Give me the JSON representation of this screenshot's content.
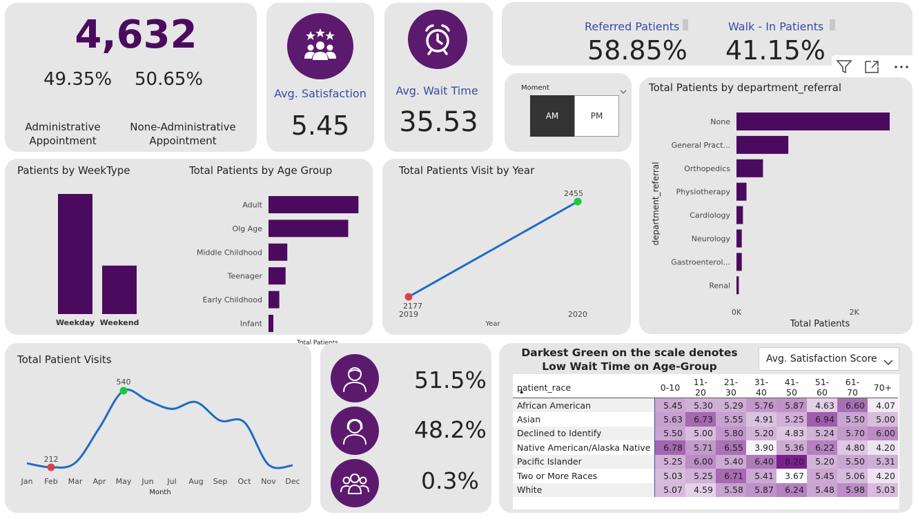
{
  "kpi_total": {
    "value": "4,632",
    "admin_pct": "49.35%",
    "nonadmin_pct": "50.65%",
    "admin_label_1": "Administrative",
    "admin_label_2": "Appointment",
    "nonadmin_label_1": "None-Administrative",
    "nonadmin_label_2": "Appointment"
  },
  "satisfaction": {
    "label": "Avg. Satisfaction",
    "value": "5.45",
    "icon": "people-stars-icon"
  },
  "wait": {
    "label": "Avg. Wait Time",
    "value": "35.53",
    "icon": "alarm-clock-icon"
  },
  "referral": {
    "referred_label": "Referred Patients",
    "referred_value": "58.85%",
    "walkin_label": "Walk - In Patients",
    "walkin_value": "41.15%"
  },
  "toolbar": {
    "filter_icon": "filter-icon",
    "focus_icon": "focus-mode-icon",
    "more_icon": "more-options-icon"
  },
  "moment": {
    "label": "Moment",
    "am": "AM",
    "pm": "PM",
    "selected": "AM"
  },
  "gender": {
    "male_pct": "51.5%",
    "female_pct": "48.2%",
    "other_pct": "0.3%"
  },
  "colors": {
    "bar": "#4a0b5e",
    "line": "#1e6bc4",
    "min_marker": "#d9434e",
    "max_marker": "#1ec83c",
    "card": "#e6e6e6",
    "accent": "#3a4aa8"
  },
  "chart_data": [
    {
      "id": "weektype",
      "type": "bar",
      "title": "Patients by WeekType",
      "categories": [
        "Weekday",
        "Weekend"
      ],
      "values": [
        3300,
        1332
      ],
      "ylim": [
        0,
        3300
      ]
    },
    {
      "id": "agegroup",
      "type": "bar",
      "orientation": "horizontal",
      "title": "Total Patients by Age Group",
      "xlabel": "Total Patients",
      "categories": [
        "Adult",
        "Olg Age",
        "Middle Childhood",
        "Teenager",
        "Early Childhood",
        "Infant"
      ],
      "values": [
        1580,
        1400,
        330,
        300,
        190,
        85
      ],
      "xlim": [
        0,
        1600
      ]
    },
    {
      "id": "year",
      "type": "line",
      "title": "Total Patients Visit by Year",
      "xlabel": "Year",
      "x": [
        "2019",
        "2020"
      ],
      "values": [
        2177,
        2455
      ],
      "ylim": [
        2177,
        2455
      ],
      "data_labels": [
        "2177",
        "2455"
      ]
    },
    {
      "id": "dept",
      "type": "bar",
      "orientation": "horizontal",
      "title": "Total Patients by department_referral",
      "xlabel": "Total Patients",
      "ylabel": "department_referral",
      "categories": [
        "None",
        "General Pract...",
        "Orthopedics",
        "Physiotherapy",
        "Cardiology",
        "Neurology",
        "Gastroenterol...",
        "Renal"
      ],
      "values": [
        2600,
        880,
        450,
        170,
        110,
        90,
        90,
        40
      ],
      "xticks": [
        "0K",
        "2K"
      ],
      "xlim": [
        0,
        2600
      ]
    },
    {
      "id": "monthly",
      "type": "line",
      "title": "Total Patient Visits",
      "xlabel": "Month",
      "x": [
        "Jan",
        "Feb",
        "Mar",
        "Apr",
        "May",
        "Jun",
        "Jul",
        "Aug",
        "Sep",
        "Oct",
        "Nov",
        "Dec"
      ],
      "values": [
        229,
        212,
        231,
        381,
        540,
        498,
        462,
        491,
        412,
        405,
        223,
        220
      ],
      "ylim": [
        200,
        540
      ],
      "min_label": "212",
      "max_label": "540"
    },
    {
      "id": "heatmap",
      "type": "heatmap",
      "title": "Darkest Green on the scale denotes Low Wait Time on Age-Group",
      "selector": "Avg. Satisfaction Score",
      "row_header": "patient_race",
      "columns": [
        "0-10",
        "11-20",
        "21-30",
        "31-40",
        "41-50",
        "51-60",
        "61-70",
        "70+"
      ],
      "rows": [
        {
          "name": "African American",
          "values": [
            "5.45",
            "5.30",
            "5.29",
            "5.76",
            "5.87",
            "4.63",
            "6.60",
            "4.07"
          ]
        },
        {
          "name": "Asian",
          "values": [
            "5.63",
            "6.73",
            "5.55",
            "4.91",
            "5.25",
            "6.94",
            "5.50",
            "5.00"
          ]
        },
        {
          "name": "Declined to Identify",
          "values": [
            "5.50",
            "5.00",
            "5.80",
            "5.20",
            "4.83",
            "5.24",
            "5.70",
            "6.00"
          ]
        },
        {
          "name": "Native American/Alaska Native",
          "values": [
            "6.78",
            "5.71",
            "6.55",
            "3.90",
            "5.36",
            "6.22",
            "4.80",
            "4.20"
          ]
        },
        {
          "name": "Pacific Islander",
          "values": [
            "5.25",
            "6.00",
            "5.40",
            "6.40",
            "8.20",
            "5.20",
            "5.50",
            "5.31"
          ]
        },
        {
          "name": "Two or More Races",
          "values": [
            "5.03",
            "5.25",
            "6.71",
            "5.41",
            "3.67",
            "5.45",
            "5.06",
            "4.20"
          ]
        },
        {
          "name": "White",
          "values": [
            "5.07",
            "4.59",
            "5.58",
            "5.87",
            "6.24",
            "5.48",
            "5.98",
            "5.03"
          ]
        }
      ],
      "scale_min": 3.67,
      "scale_max": 8.2
    }
  ]
}
